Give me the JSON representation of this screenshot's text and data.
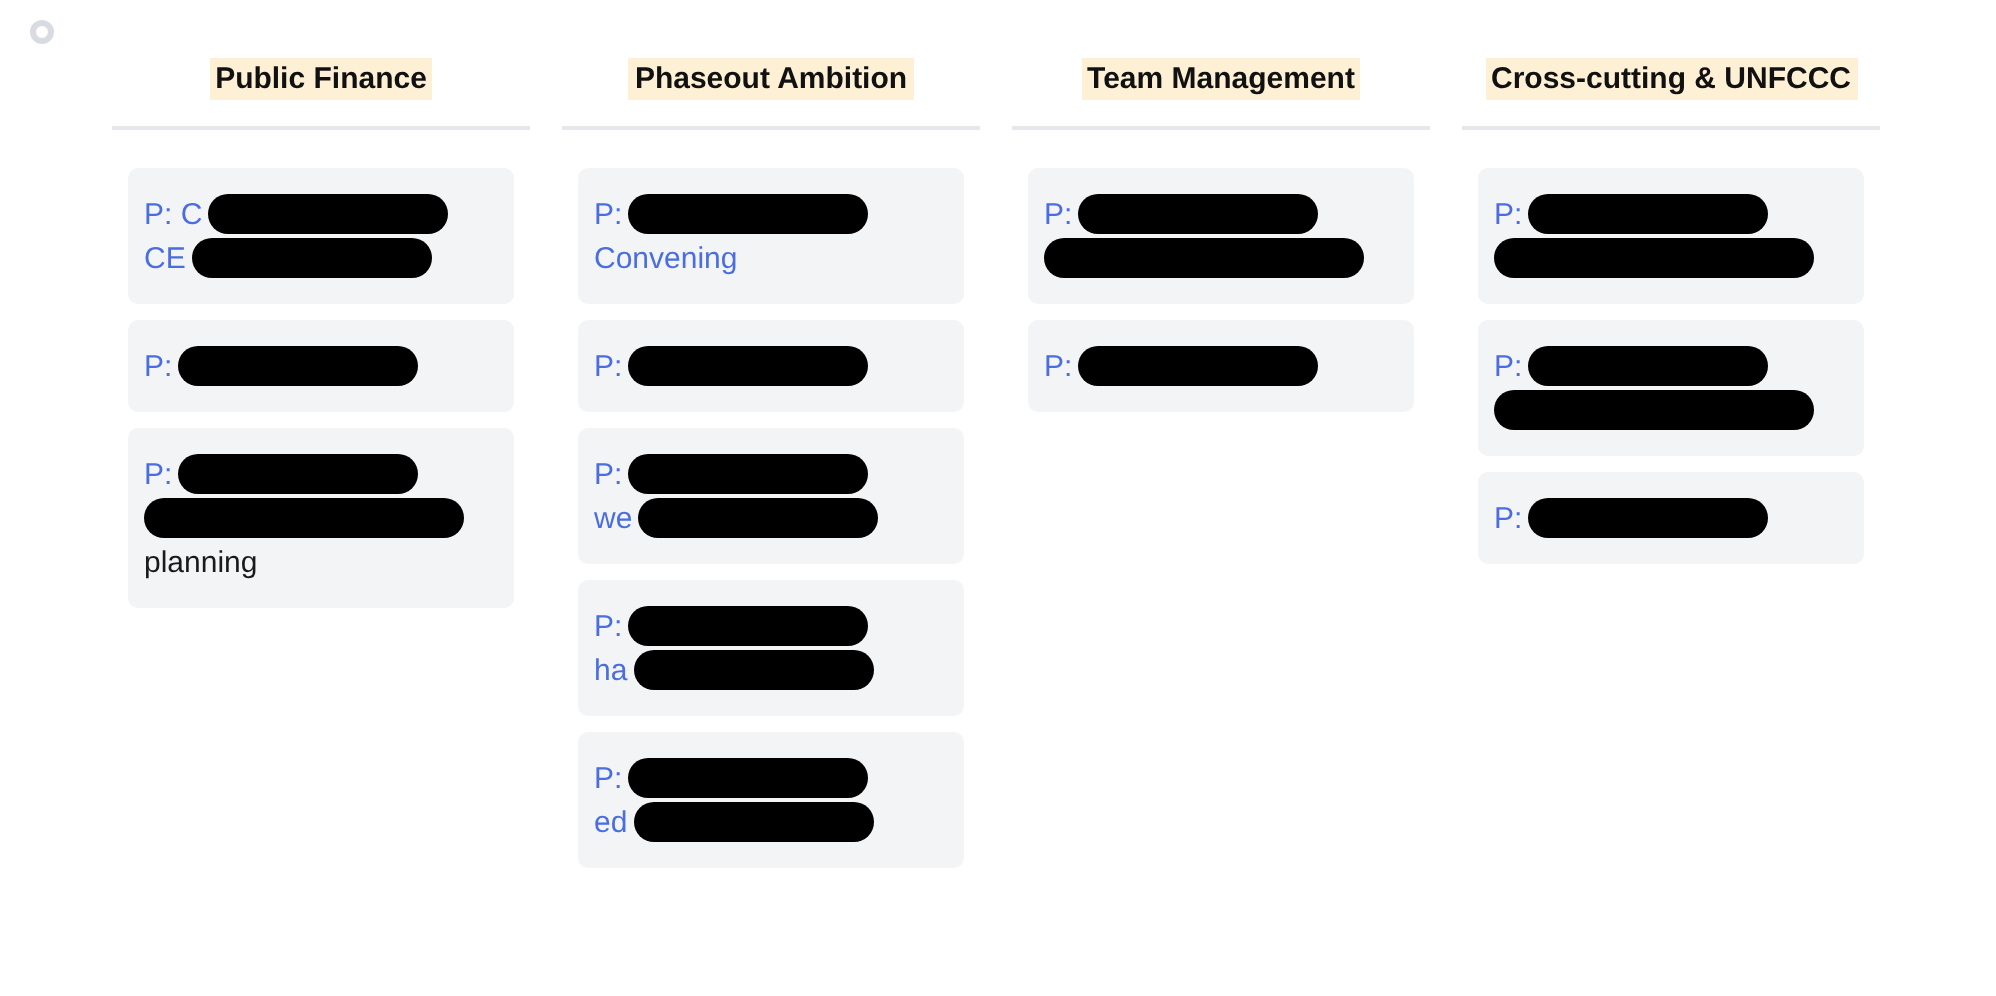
{
  "columns": [
    {
      "title": "Public Finance",
      "cards": [
        {
          "lines": [
            {
              "kind": "link",
              "text": "P: C",
              "redacted": true
            },
            {
              "kind": "link",
              "text": "CE",
              "redacted": true
            }
          ]
        },
        {
          "lines": [
            {
              "kind": "link",
              "text": "P:",
              "redacted": true
            }
          ]
        },
        {
          "lines": [
            {
              "kind": "link",
              "text": "P:",
              "redacted": true
            },
            {
              "kind": "link",
              "redacted": true
            },
            {
              "kind": "plain",
              "text": "planning",
              "redacted": false
            }
          ]
        }
      ]
    },
    {
      "title": "Phaseout Ambition",
      "cards": [
        {
          "lines": [
            {
              "kind": "link",
              "text": "P:",
              "redacted": true
            },
            {
              "kind": "link",
              "text": "Convening",
              "redacted": false
            }
          ]
        },
        {
          "lines": [
            {
              "kind": "link",
              "text": "P:",
              "redacted": true
            }
          ]
        },
        {
          "lines": [
            {
              "kind": "link",
              "text": "P:",
              "redacted": true
            },
            {
              "kind": "link",
              "text": "we",
              "redacted": true
            }
          ]
        },
        {
          "lines": [
            {
              "kind": "link",
              "text": "P:",
              "redacted": true
            },
            {
              "kind": "link",
              "text": "ha",
              "redacted": true
            }
          ]
        },
        {
          "lines": [
            {
              "kind": "link",
              "text": "P:",
              "redacted": true
            },
            {
              "kind": "link",
              "text": "ed",
              "redacted": true
            }
          ]
        }
      ]
    },
    {
      "title": "Team Management",
      "cards": [
        {
          "lines": [
            {
              "kind": "link",
              "text": "P:",
              "redacted": true
            },
            {
              "kind": "link",
              "redacted": true
            }
          ]
        },
        {
          "lines": [
            {
              "kind": "link",
              "text": "P:",
              "redacted": true
            }
          ]
        }
      ]
    },
    {
      "title": "Cross-cutting & UNFCCC",
      "cards": [
        {
          "lines": [
            {
              "kind": "link",
              "text": "P:",
              "redacted": true
            },
            {
              "kind": "link",
              "redacted": true
            }
          ]
        },
        {
          "lines": [
            {
              "kind": "link",
              "text": "P:",
              "redacted": true
            },
            {
              "kind": "link",
              "redacted": true
            }
          ]
        },
        {
          "lines": [
            {
              "kind": "link",
              "text": "P:",
              "redacted": true
            }
          ]
        }
      ]
    }
  ]
}
